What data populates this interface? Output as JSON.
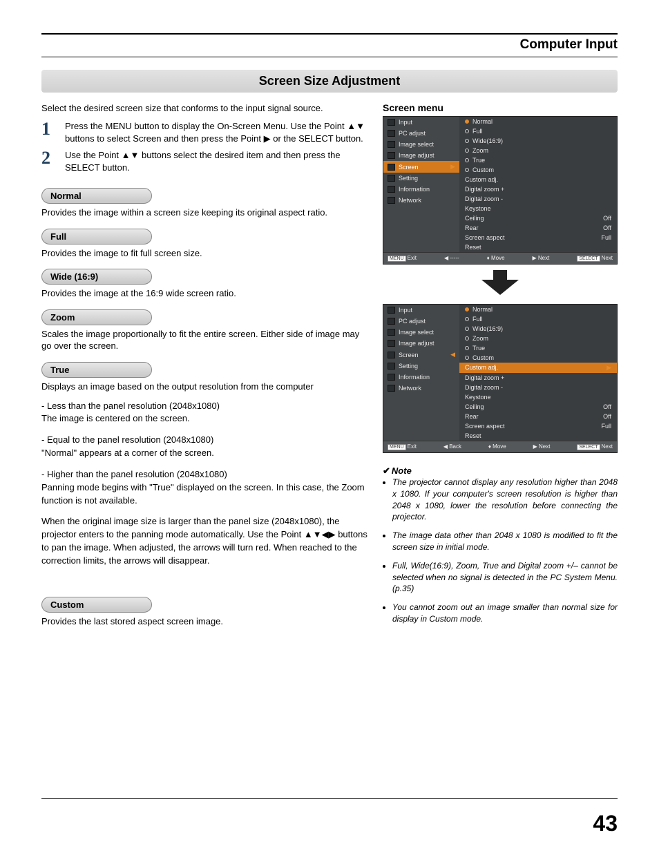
{
  "header": {
    "section": "Computer Input"
  },
  "title": "Screen Size Adjustment",
  "intro": "Select the desired screen size that conforms to the input signal source.",
  "steps": [
    {
      "num": "1",
      "text": "Press the MENU button to display the On-Screen Menu. Use the Point ▲▼ buttons to select Screen and then press the Point ▶ or the SELECT button."
    },
    {
      "num": "2",
      "text": "Use the Point ▲▼ buttons select the desired item and then press the SELECT button."
    }
  ],
  "blocks": {
    "normal": {
      "label": "Normal",
      "desc": "Provides the image within a screen size keeping its original aspect ratio."
    },
    "full": {
      "label": "Full",
      "desc": "Provides the image to fit full screen size."
    },
    "wide": {
      "label": "Wide (16:9)",
      "desc": "Provides the image at the 16:9 wide screen ratio."
    },
    "zoom": {
      "label": "Zoom",
      "desc": "Scales the image proportionally to fit the entire screen. Either side of image may go over the screen."
    },
    "true": {
      "label": "True",
      "desc": "Displays an image based on the output resolution from the computer",
      "sub1a": "- Less than the panel resolution (2048x1080)",
      "sub1b": "  The image is centered on the screen.",
      "sub2a": "- Equal to the panel resolution (2048x1080)",
      "sub2b": "  \"Normal\" appears at a corner of the screen.",
      "sub3a": "- Higher than the panel resolution (2048x1080)",
      "sub3b": "  Panning mode begins with \"True\" displayed on the screen. In this case, the Zoom function is not available.",
      "sub4": "When the original image size is larger than the panel size (2048x1080), the projector enters to the panning mode automatically. Use the Point ▲▼◀▶ buttons to pan the image. When adjusted, the arrows will turn red. When reached to the correction limits, the arrows will disappear."
    },
    "custom": {
      "label": "Custom",
      "desc": "Provides the last stored aspect screen image."
    }
  },
  "screen_menu": {
    "title": "Screen menu",
    "left_items": [
      "Input",
      "PC adjust",
      "Image select",
      "Image adjust",
      "Screen",
      "Setting",
      "Information",
      "Network"
    ],
    "right_options": [
      "Normal",
      "Full",
      "Wide(16:9)",
      "Zoom",
      "True",
      "Custom"
    ],
    "right_extra": [
      {
        "l": "Custom adj.",
        "r": ""
      },
      {
        "l": "Digital zoom +",
        "r": ""
      },
      {
        "l": "Digital zoom -",
        "r": ""
      },
      {
        "l": "Keystone",
        "r": ""
      },
      {
        "l": "Ceiling",
        "r": "Off"
      },
      {
        "l": "Rear",
        "r": "Off"
      },
      {
        "l": "Screen aspect",
        "r": "Full"
      },
      {
        "l": "Reset",
        "r": ""
      }
    ],
    "footer1": {
      "exit": "Exit",
      "move": "Move",
      "next": "Next",
      "select": "Next",
      "back": "-----"
    },
    "footer2": {
      "exit": "Exit",
      "move": "Move",
      "next": "Next",
      "select": "Next",
      "back": "Back"
    },
    "menu_label": "MENU",
    "select_label": "SELECT"
  },
  "note_title": "Note",
  "notes": [
    "The projector cannot display any resolution higher than 2048 x 1080. If your computer's screen resolution is higher than 2048 x 1080, lower the resolution before connecting the projector.",
    "The image data other than 2048 x 1080 is modified to fit the screen size in initial mode.",
    "Full, Wide(16:9), Zoom, True and Digital zoom +/– cannot be selected when no signal is detected in the PC System Menu. (p.35)",
    "You cannot zoom out  an image smaller than normal size for display in Custom mode."
  ],
  "page_number": "43"
}
